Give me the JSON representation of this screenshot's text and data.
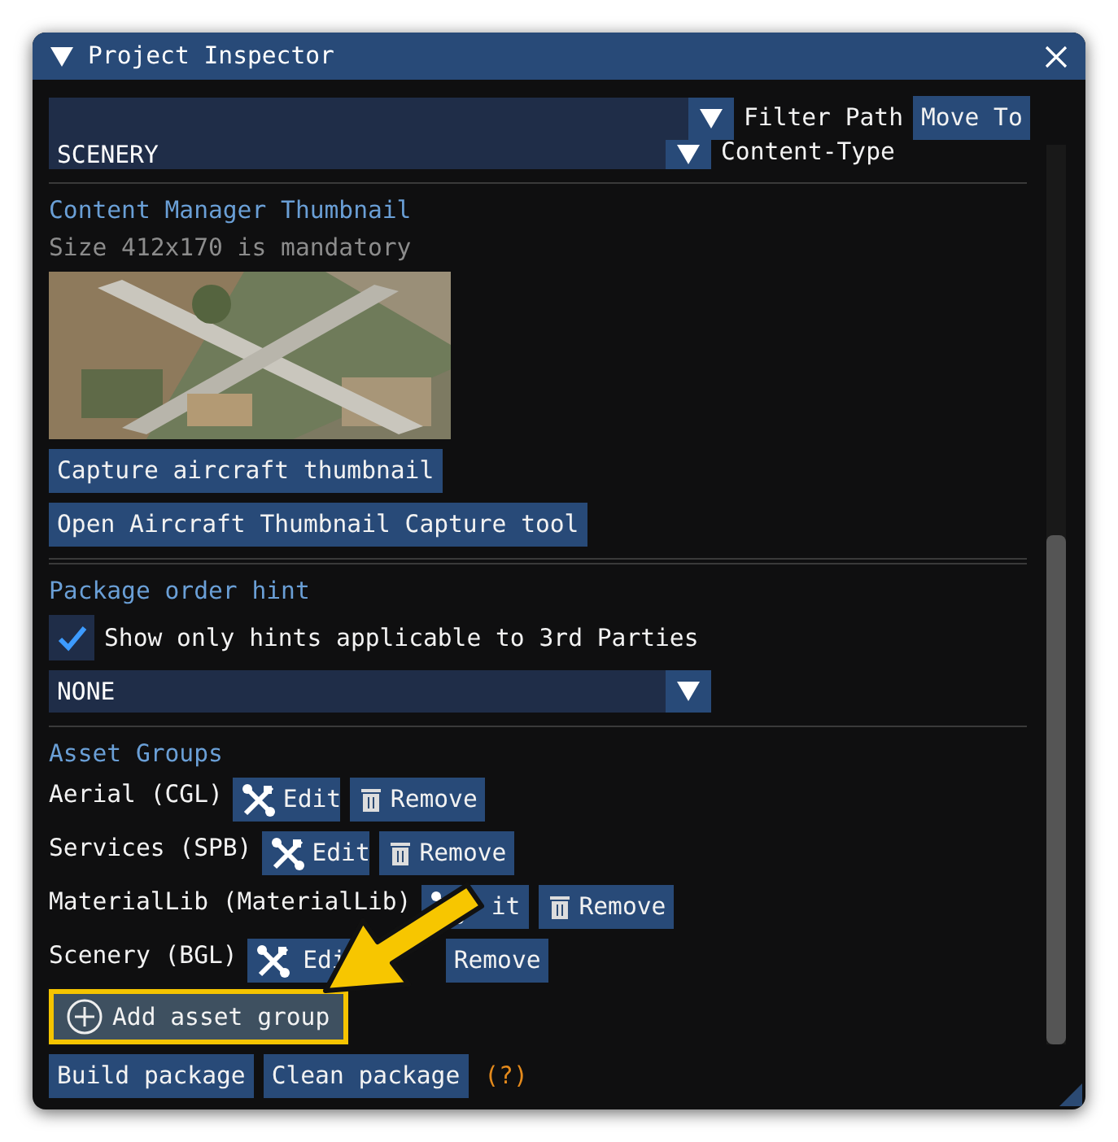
{
  "window": {
    "title": "Project Inspector"
  },
  "filter": {
    "label": "Filter Path",
    "action": "Move To"
  },
  "content_type": {
    "value": "SCENERY",
    "label": "Content-Type"
  },
  "thumbnail_section": {
    "heading": "Content Manager Thumbnail",
    "note": "Size 412x170 is mandatory",
    "buttons": [
      "Capture aircraft thumbnail",
      "Open Aircraft Thumbnail Capture tool"
    ]
  },
  "package_order_hint": {
    "heading": "Package order hint",
    "checkbox": {
      "label": "Show only hints applicable to 3rd Parties",
      "checked": true
    },
    "dropdown": {
      "value": "NONE"
    }
  },
  "asset_groups": {
    "heading": "Asset Groups",
    "items": [
      {
        "name": "Aerial (CGL)",
        "edit": "Edit",
        "remove": "Remove",
        "remove_icon": true
      },
      {
        "name": "Services (SPB)",
        "edit": "Edit",
        "remove": "Remove",
        "remove_icon": true
      },
      {
        "name": "MaterialLib (MaterialLib)",
        "edit": "it",
        "remove": "Remove",
        "remove_icon": true
      },
      {
        "name": "Scenery (BGL)",
        "edit": "Edi",
        "remove": "Remove",
        "remove_icon": false
      }
    ],
    "add_button": {
      "label": "Add asset group",
      "highlighted": true
    }
  },
  "footer": {
    "buttons": [
      "Build package",
      "Clean package"
    ],
    "help": "(?)"
  }
}
